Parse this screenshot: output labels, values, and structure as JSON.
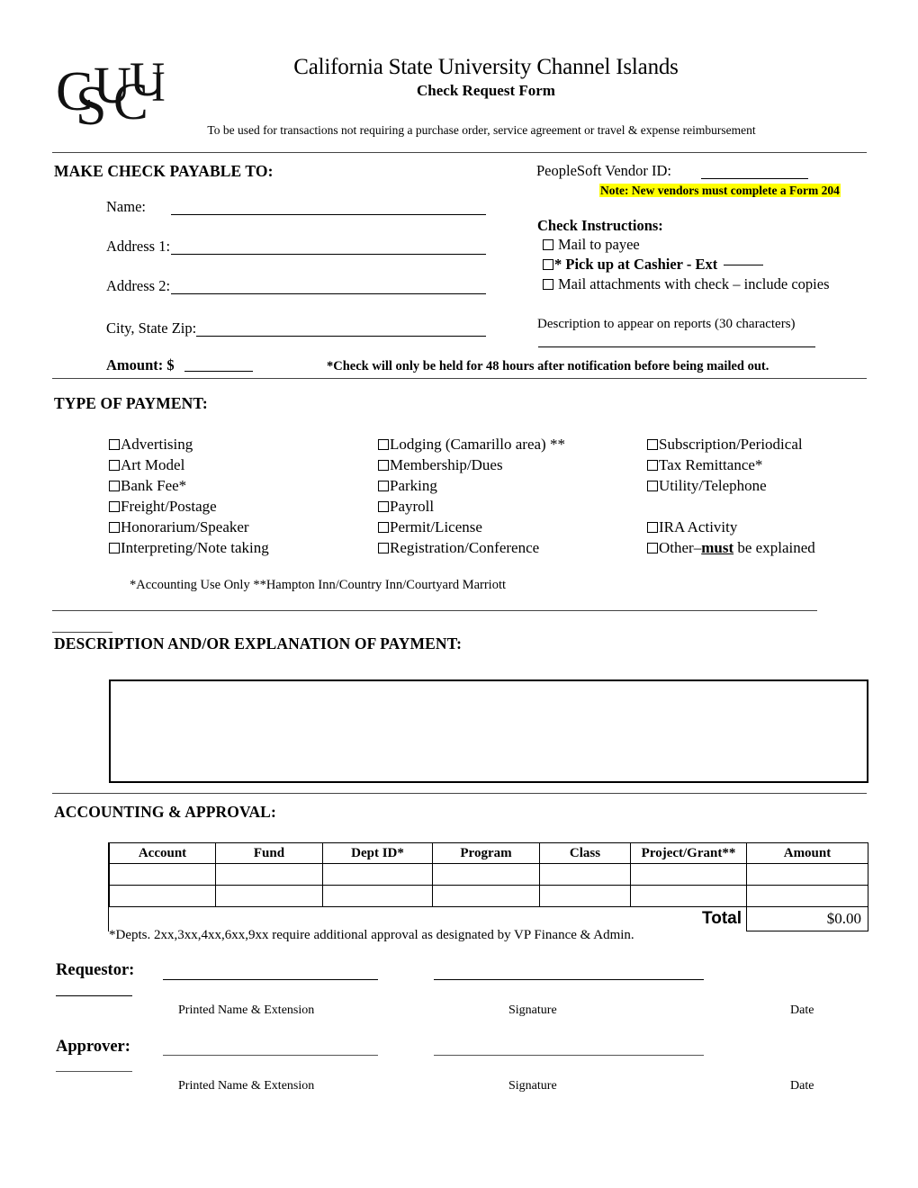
{
  "header": {
    "logo_alt": "csuci-monogram-logo",
    "university": "California State University Channel Islands",
    "form_title": "Check Request Form",
    "subtitle": "To be used for transactions not requiring a purchase order, service agreement or travel & expense reimbursement"
  },
  "payable": {
    "heading": "MAKE CHECK PAYABLE TO:",
    "name_label": "Name:",
    "name_value": "",
    "address1_label": "Address 1:",
    "address1_value": "",
    "address2_label": "Address 2:",
    "address2_value": "",
    "city_label": "City, State Zip:",
    "city_value": "",
    "amount_label": "Amount:  $",
    "amount_value": "",
    "amount_note": "*Check will only be held for 48 hours after notification before being mailed out."
  },
  "vendor": {
    "id_label": "PeopleSoft Vendor ID:",
    "id_value": "",
    "note": "Note:  New vendors must complete a Form 204",
    "note_highlight_color": "#ffff00"
  },
  "check_instructions": {
    "heading": "Check Instructions:",
    "options": [
      {
        "label": "Mail to payee",
        "bold": false,
        "checked": false
      },
      {
        "label": "* Pick up at Cashier -  Ext",
        "bold": true,
        "checked": false
      },
      {
        "label": "Mail attachments with check – include copies",
        "bold": false,
        "checked": false
      }
    ],
    "ext_value": "",
    "report_desc_label": "Description to appear on reports (30 characters)",
    "report_desc_value": ""
  },
  "payment_type": {
    "heading": "TYPE OF PAYMENT:",
    "column1": [
      {
        "label": "Advertising",
        "checked": false
      },
      {
        "label": "Art Model",
        "checked": false
      },
      {
        "label": "Bank Fee*",
        "checked": false
      },
      {
        "label": "Freight/Postage",
        "checked": false
      },
      {
        "label": "Honorarium/Speaker",
        "checked": false
      },
      {
        "label": "Interpreting/Note taking",
        "checked": false
      }
    ],
    "column2": [
      {
        "label": "Lodging (Camarillo area) **",
        "checked": false
      },
      {
        "label": "Membership/Dues",
        "checked": false
      },
      {
        "label": "Parking",
        "checked": false
      },
      {
        "label": "Payroll",
        "checked": false
      },
      {
        "label": "Permit/License",
        "checked": false
      },
      {
        "label": "Registration/Conference",
        "checked": false
      }
    ],
    "column3": [
      {
        "label": "Subscription/Periodical",
        "checked": false
      },
      {
        "label": "Tax Remittance*",
        "checked": false
      },
      {
        "label": "Utility/Telephone",
        "checked": false
      },
      {
        "label": "",
        "checked": null
      },
      {
        "label": "IRA Activity",
        "checked": false
      },
      {
        "label": "Other–must be explained",
        "checked": false
      }
    ],
    "other_prefix": "Other–",
    "other_emphasis": "must",
    "other_suffix": " be explained",
    "footnotes": "*Accounting Use Only      **Hampton Inn/Country Inn/Courtyard Marriott"
  },
  "description": {
    "heading": "DESCRIPTION AND/OR EXPLANATION OF PAYMENT:",
    "value": ""
  },
  "accounting": {
    "heading": "ACCOUNTING & APPROVAL:",
    "columns": [
      "Account",
      "Fund",
      "Dept ID*",
      "Program",
      "Class",
      "Project/Grant**",
      "Amount"
    ],
    "rows": [
      [
        "",
        "",
        "",
        "",
        "",
        "",
        ""
      ],
      [
        "",
        "",
        "",
        "",
        "",
        "",
        ""
      ]
    ],
    "total_label": "Total",
    "total_value": "$0.00",
    "footnote": "*Depts. 2xx,3xx,4xx,6xx,9xx require additional approval as designated by VP Finance & Admin."
  },
  "signatures": {
    "requestor_label": "Requestor:",
    "approver_label": "Approver:",
    "caption_name": "Printed Name & Extension",
    "caption_signature": "Signature",
    "caption_date": "Date",
    "requestor_name": "",
    "requestor_signature": "",
    "requestor_date": "",
    "approver_name": "",
    "approver_signature": "",
    "approver_date": ""
  }
}
